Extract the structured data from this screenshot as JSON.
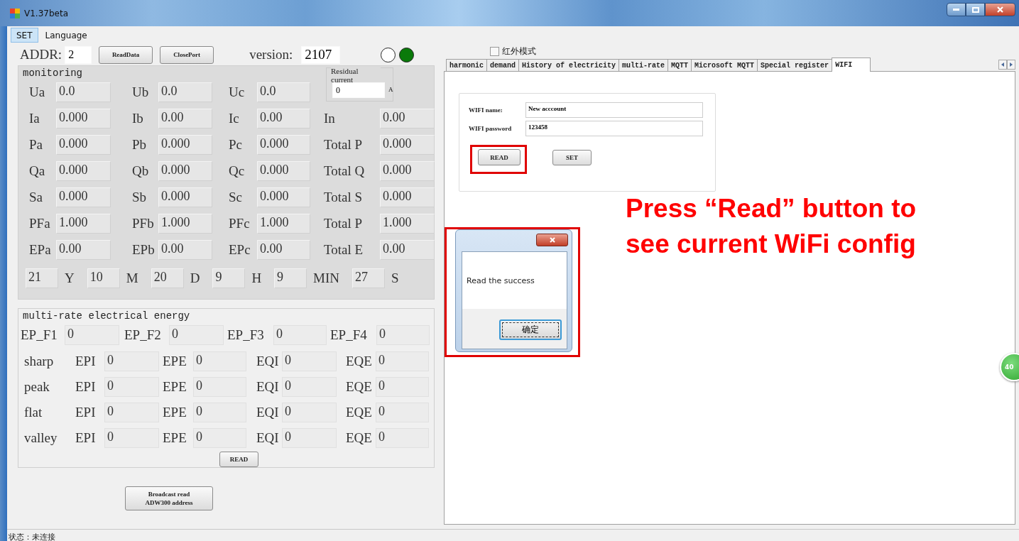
{
  "window": {
    "title": "V1.37beta"
  },
  "menu": [
    {
      "label": "SET",
      "selected": true
    },
    {
      "label": "Language",
      "selected": false
    }
  ],
  "toolbar": {
    "addr_label": "ADDR:",
    "addr_value": "2",
    "buttons": [
      "ReadData",
      "ClosePort"
    ],
    "version_label": "version:",
    "version_value": "2107",
    "indicators": [
      {
        "on": false
      },
      {
        "on": true
      }
    ]
  },
  "monitoring": {
    "title": "monitoring",
    "residual": {
      "label": "Residual current",
      "value": "0",
      "unit": "A"
    },
    "rows": [
      [
        {
          "label": "Ua",
          "value": "0.0"
        },
        {
          "label": "Ub",
          "value": "0.0"
        },
        {
          "label": "Uc",
          "value": "0.0"
        }
      ],
      [
        {
          "label": "Ia",
          "value": "0.000"
        },
        {
          "label": "Ib",
          "value": "0.00"
        },
        {
          "label": "Ic",
          "value": "0.00"
        },
        {
          "label": "In",
          "value": "0.00"
        }
      ],
      [
        {
          "label": "Pa",
          "value": "0.000"
        },
        {
          "label": "Pb",
          "value": "0.000"
        },
        {
          "label": "Pc",
          "value": "0.000"
        },
        {
          "label": "Total P",
          "value": "0.000"
        }
      ],
      [
        {
          "label": "Qa",
          "value": "0.000"
        },
        {
          "label": "Qb",
          "value": "0.000"
        },
        {
          "label": "Qc",
          "value": "0.000"
        },
        {
          "label": "Total Q",
          "value": "0.000"
        }
      ],
      [
        {
          "label": "Sa",
          "value": "0.000"
        },
        {
          "label": "Sb",
          "value": "0.000"
        },
        {
          "label": "Sc",
          "value": "0.000"
        },
        {
          "label": "Total S",
          "value": "0.000"
        }
      ],
      [
        {
          "label": "PFa",
          "value": "1.000"
        },
        {
          "label": "PFb",
          "value": "1.000"
        },
        {
          "label": "PFc",
          "value": "1.000"
        },
        {
          "label": "Total P",
          "value": "1.000"
        }
      ],
      [
        {
          "label": "EPa",
          "value": "0.00"
        },
        {
          "label": "EPb",
          "value": "0.00"
        },
        {
          "label": "EPc",
          "value": "0.00"
        },
        {
          "label": "Total E",
          "value": "0.00"
        }
      ]
    ],
    "datetime": [
      {
        "value": "21",
        "unit": "Y"
      },
      {
        "value": "10",
        "unit": "M"
      },
      {
        "value": "20",
        "unit": "D"
      },
      {
        "value": "9",
        "unit": "H"
      },
      {
        "value": "9",
        "unit": "MIN"
      },
      {
        "value": "27",
        "unit": "S"
      }
    ]
  },
  "multi_rate": {
    "title": "multi-rate electrical energy",
    "totals": [
      {
        "label": "EP_F1",
        "value": "0"
      },
      {
        "label": "EP_F2",
        "value": "0"
      },
      {
        "label": "EP_F3",
        "value": "0"
      },
      {
        "label": "EP_F4",
        "value": "0"
      }
    ],
    "rows": [
      {
        "name": "sharp",
        "cells": [
          {
            "label": "EPI",
            "value": "0"
          },
          {
            "label": "EPE",
            "value": "0"
          },
          {
            "label": "EQI",
            "value": "0"
          },
          {
            "label": "EQE",
            "value": "0"
          }
        ]
      },
      {
        "name": "peak",
        "cells": [
          {
            "label": "EPI",
            "value": "0"
          },
          {
            "label": "EPE",
            "value": "0"
          },
          {
            "label": "EQI",
            "value": "0"
          },
          {
            "label": "EQE",
            "value": "0"
          }
        ]
      },
      {
        "name": "flat",
        "cells": [
          {
            "label": "EPI",
            "value": "0"
          },
          {
            "label": "EPE",
            "value": "0"
          },
          {
            "label": "EQI",
            "value": "0"
          },
          {
            "label": "EQE",
            "value": "0"
          }
        ]
      },
      {
        "name": "valley",
        "cells": [
          {
            "label": "EPI",
            "value": "0"
          },
          {
            "label": "EPE",
            "value": "0"
          },
          {
            "label": "EQI",
            "value": "0"
          },
          {
            "label": "EQE",
            "value": "0"
          }
        ]
      }
    ],
    "button": "READ"
  },
  "broadcast_button": "Broadcast read\nADW300 address",
  "infrared_mode": {
    "label": "红外模式",
    "checked": false
  },
  "tabs": [
    {
      "label": "harmonic",
      "selected": false
    },
    {
      "label": "demand",
      "selected": false
    },
    {
      "label": "History of electricity",
      "selected": false
    },
    {
      "label": "multi-rate",
      "selected": false
    },
    {
      "label": "MQTT",
      "selected": false
    },
    {
      "label": "Microsoft MQTT",
      "selected": false
    },
    {
      "label": "Special register",
      "selected": false
    },
    {
      "label": "WIFI",
      "selected": true
    }
  ],
  "wifi": {
    "name_label": "WIFI name:",
    "name_value": "New acccount",
    "password_label": "WIFI password",
    "password_value": "123458",
    "buttons": [
      {
        "label": "READ",
        "highlighted": true
      },
      {
        "label": "SET",
        "highlighted": false
      }
    ]
  },
  "dialog": {
    "message": "Read the success",
    "ok": "确定",
    "highlighted": true
  },
  "annotation": "Press “Read” button to see current WiFi config",
  "floating_badge": "40",
  "status_bar": "状态：未连接"
}
